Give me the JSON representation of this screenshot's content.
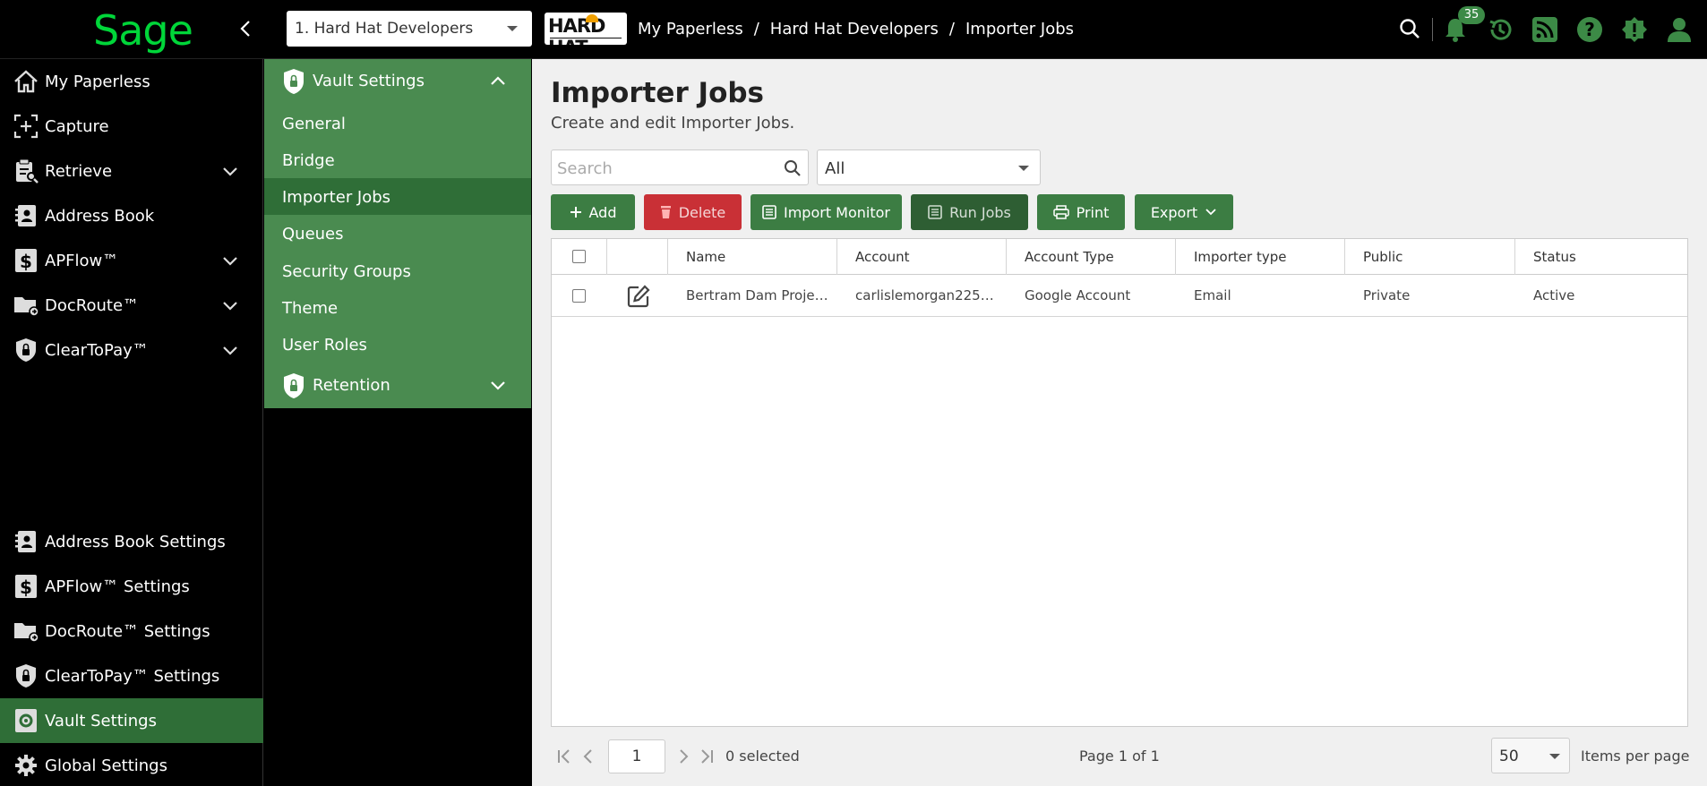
{
  "app": {
    "logo": "Sage"
  },
  "header": {
    "tenant": "1. Hard Hat Developers",
    "company_logo_text": "HARD HAT",
    "breadcrumb": [
      "My Paperless",
      "Hard Hat Developers",
      "Importer Jobs"
    ],
    "notification_count": "35"
  },
  "sidebar": {
    "items": [
      {
        "label": "My Paperless"
      },
      {
        "label": "Capture"
      },
      {
        "label": "Retrieve"
      },
      {
        "label": "Address Book"
      },
      {
        "label": "APFlow™"
      },
      {
        "label": "DocRoute™"
      },
      {
        "label": "ClearToPay™"
      }
    ],
    "settings": [
      {
        "label": "Address Book Settings"
      },
      {
        "label": "APFlow™ Settings"
      },
      {
        "label": "DocRoute™ Settings"
      },
      {
        "label": "ClearToPay™ Settings"
      },
      {
        "label": "Vault Settings"
      },
      {
        "label": "Global Settings"
      }
    ]
  },
  "submenu": {
    "header": "Vault Settings",
    "items": [
      "General",
      "Bridge",
      "Importer Jobs",
      "Queues",
      "Security Groups",
      "Theme",
      "User Roles"
    ],
    "footer": "Retention"
  },
  "main": {
    "title": "Importer Jobs",
    "subtitle": "Create and edit Importer Jobs.",
    "search_placeholder": "Search",
    "filter_value": "All",
    "toolbar": {
      "add": "Add",
      "delete": "Delete",
      "import_monitor": "Import Monitor",
      "run_jobs": "Run Jobs",
      "print": "Print",
      "export": "Export"
    },
    "columns": [
      "Name",
      "Account",
      "Account Type",
      "Importer type",
      "Public",
      "Status"
    ],
    "rows": [
      {
        "name": "Bertram Dam Proje…",
        "account": "carlislemorgan225…",
        "account_type": "Google Account",
        "importer_type": "Email",
        "public": "Private",
        "status": "Active"
      }
    ],
    "pager": {
      "page": "1",
      "selected": "0 selected",
      "page_info": "Page 1 of 1",
      "page_size": "50",
      "items_per_page": "Items per page"
    }
  },
  "colors": {
    "accent": "#4a8b50",
    "active": "#2f6e37",
    "logo": "#00d639",
    "danger": "#c93036"
  }
}
